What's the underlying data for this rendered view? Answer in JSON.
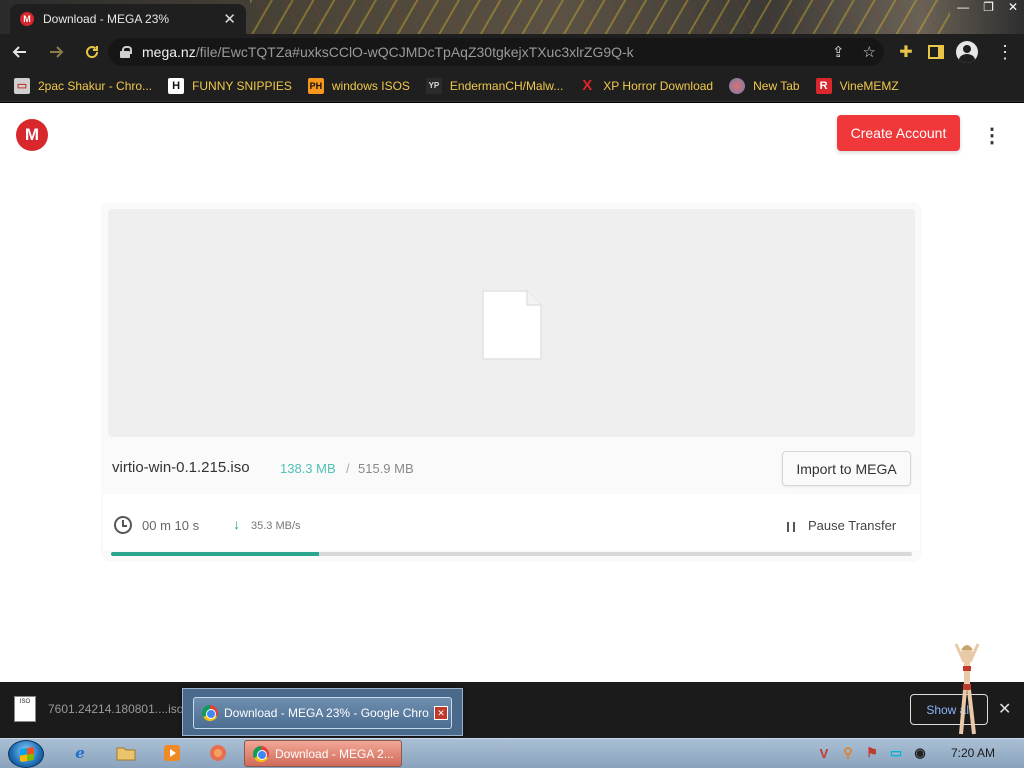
{
  "browser": {
    "tab_title": "Download - MEGA 23%",
    "tab_favicon": "M",
    "url_host": "mega.nz",
    "url_path": "/file/EwcTQTZa#uxksCClO-wQCJMDcTpAqZ30tgkejxTXuc3xlrZG9Q-k"
  },
  "bookmarks": [
    {
      "icon": "monitor-icon",
      "label": "2pac Shakur - Chro..."
    },
    {
      "icon": "H",
      "label": "FUNNY SNIPPIES"
    },
    {
      "icon": "PH",
      "label": "windows ISOS"
    },
    {
      "icon": "YP",
      "label": "EndermanCH/Malw..."
    },
    {
      "icon": "X",
      "label": "XP Horror Download"
    },
    {
      "icon": "globe-icon",
      "label": "New Tab"
    },
    {
      "icon": "R",
      "label": "VineMEMZ"
    }
  ],
  "page": {
    "logo": "M",
    "create_account": "Create Account"
  },
  "download": {
    "file_name": "virtio-win-0.1.215.iso",
    "downloaded": "138.3 MB",
    "separator": "/",
    "total": "515.9 MB",
    "import_label": "Import to MEGA",
    "time_left": "00 m  10 s",
    "speed": "35.3 MB/s",
    "pause_label": "Pause Transfer",
    "progress_percent": 26
  },
  "shelf": {
    "item_name": "7601.24214.180801....iso",
    "iso_icon": "ISO",
    "thumb_title": "Download - MEGA 23% - Google Chro...",
    "show_all": "Show all"
  },
  "taskbar": {
    "active_label": "Download - MEGA 2...",
    "clock": "7:20 AM"
  },
  "colors": {
    "mega_red": "#d9272e",
    "create_btn": "#f0373a",
    "progress": "#2ba58d",
    "downloaded_text": "#4fc3b5",
    "bookmark_text": "#f2c94c"
  }
}
